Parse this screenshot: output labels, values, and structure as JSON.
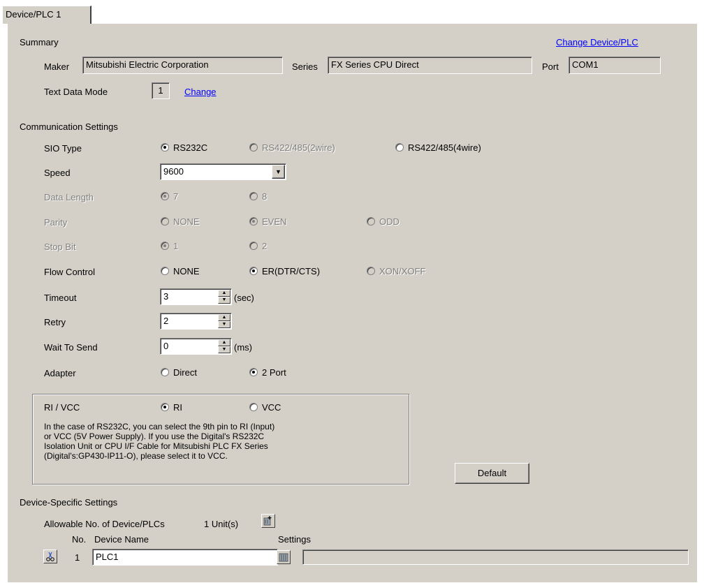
{
  "tab": {
    "label": "Device/PLC 1"
  },
  "summary": {
    "title": "Summary",
    "change_link": "Change Device/PLC",
    "maker_label": "Maker",
    "maker_value": "Mitsubishi Electric Corporation",
    "series_label": "Series",
    "series_value": "FX Series CPU Direct",
    "port_label": "Port",
    "port_value": "COM1",
    "text_mode_label": "Text Data Mode",
    "text_mode_value": "1",
    "text_mode_change": "Change"
  },
  "comm": {
    "title": "Communication Settings",
    "sio_label": "SIO Type",
    "sio_options": [
      "RS232C",
      "RS422/485(2wire)",
      "RS422/485(4wire)"
    ],
    "speed_label": "Speed",
    "speed_value": "9600",
    "data_length_label": "Data Length",
    "data_length_options": [
      "7",
      "8"
    ],
    "parity_label": "Parity",
    "parity_options": [
      "NONE",
      "EVEN",
      "ODD"
    ],
    "stop_bit_label": "Stop Bit",
    "stop_bit_options": [
      "1",
      "2"
    ],
    "flow_label": "Flow Control",
    "flow_options": [
      "NONE",
      "ER(DTR/CTS)",
      "XON/XOFF"
    ],
    "timeout_label": "Timeout",
    "timeout_value": "3",
    "timeout_unit": "(sec)",
    "retry_label": "Retry",
    "retry_value": "2",
    "wait_label": "Wait To Send",
    "wait_value": "0",
    "wait_unit": "(ms)",
    "adapter_label": "Adapter",
    "adapter_options": [
      "Direct",
      "2 Port"
    ],
    "rivcc_label": "RI / VCC",
    "rivcc_options": [
      "RI",
      "VCC"
    ],
    "rivcc_note_1": "In the case of RS232C, you can select the 9th pin to RI (Input)",
    "rivcc_note_2": "or VCC (5V Power Supply). If you use the Digital's RS232C",
    "rivcc_note_3": "Isolation Unit or  CPU I/F Cable for Mitsubishi PLC FX Series",
    "rivcc_note_4": "(Digital's:GP430-IP11-O), please select it to VCC.",
    "default_button": "Default"
  },
  "device": {
    "title": "Device-Specific Settings",
    "allowable_label": "Allowable No. of Device/PLCs",
    "allowable_value": "1 Unit(s)",
    "col_no": "No.",
    "col_name": "Device Name",
    "col_settings": "Settings",
    "rows": [
      {
        "no": "1",
        "name": "PLC1"
      }
    ]
  }
}
